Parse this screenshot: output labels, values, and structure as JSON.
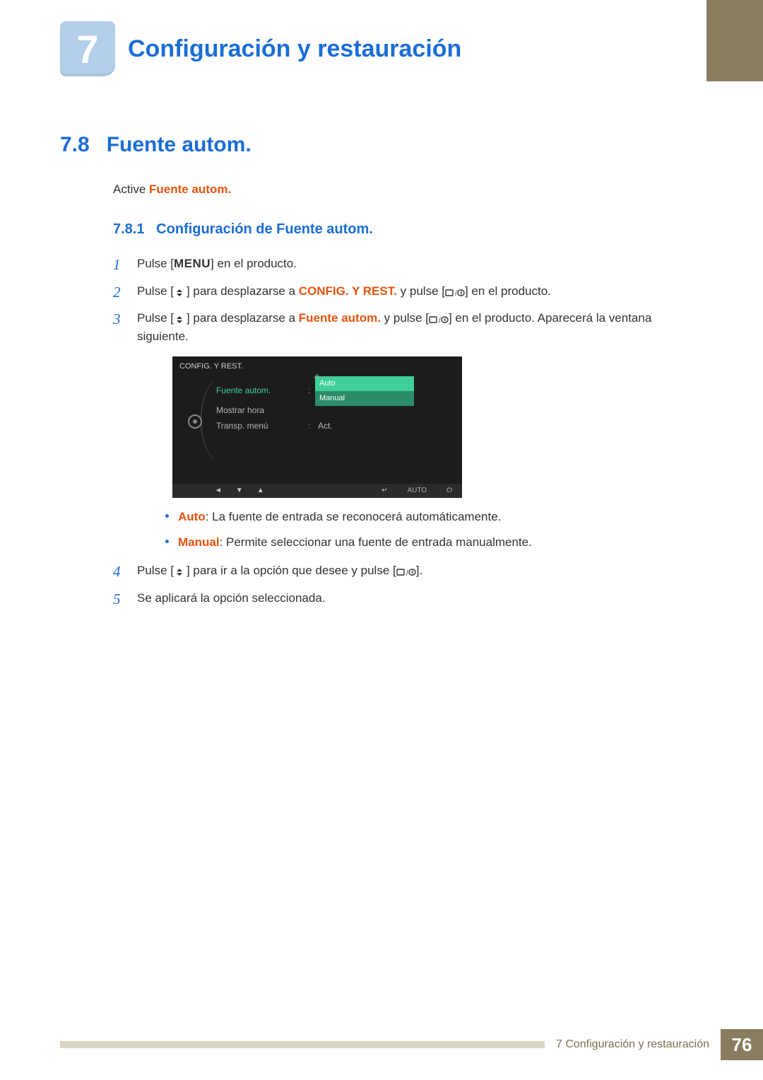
{
  "chapter": {
    "number": "7",
    "title": "Configuración y restauración"
  },
  "section": {
    "number": "7.8",
    "title": "Fuente autom."
  },
  "intro": {
    "prefix": "Active ",
    "keyword": "Fuente autom."
  },
  "subsection": {
    "number": "7.8.1",
    "title": "Configuración de Fuente autom."
  },
  "steps": {
    "s1": {
      "a": "Pulse [",
      "menu": "MENU",
      "b": "] en el producto."
    },
    "s2": {
      "a": "Pulse [",
      "b": "] para desplazarse a ",
      "kw": "CONFIG. Y REST.",
      "c": " y pulse [",
      "d": "] en el producto."
    },
    "s3": {
      "a": "Pulse [",
      "b": "] para desplazarse a ",
      "kw": "Fuente autom.",
      "c": " y pulse [",
      "d": "] en el producto. Aparecerá la ventana siguiente."
    },
    "s4": {
      "a": "Pulse [",
      "b": "] para ir a la opción que desee y pulse [",
      "c": "]."
    },
    "s5": "Se aplicará la opción seleccionada."
  },
  "bullets": {
    "auto": {
      "kw": "Auto",
      "text": ": La fuente de entrada se reconocerá automáticamente."
    },
    "manual": {
      "kw": "Manual",
      "text": ": Permite seleccionar una fuente de entrada manualmente."
    }
  },
  "osd": {
    "title": "CONFIG. Y REST.",
    "rows": [
      {
        "label": "Fuente autom.",
        "value_auto": "Auto",
        "value_manual": "Manual"
      },
      {
        "label": "Mostrar hora",
        "value": ""
      },
      {
        "label": "Transp. menú",
        "value": "Act."
      }
    ],
    "bottom": {
      "auto": "AUTO"
    }
  },
  "footer": {
    "label": "7 Configuración y restauración",
    "page": "76"
  }
}
